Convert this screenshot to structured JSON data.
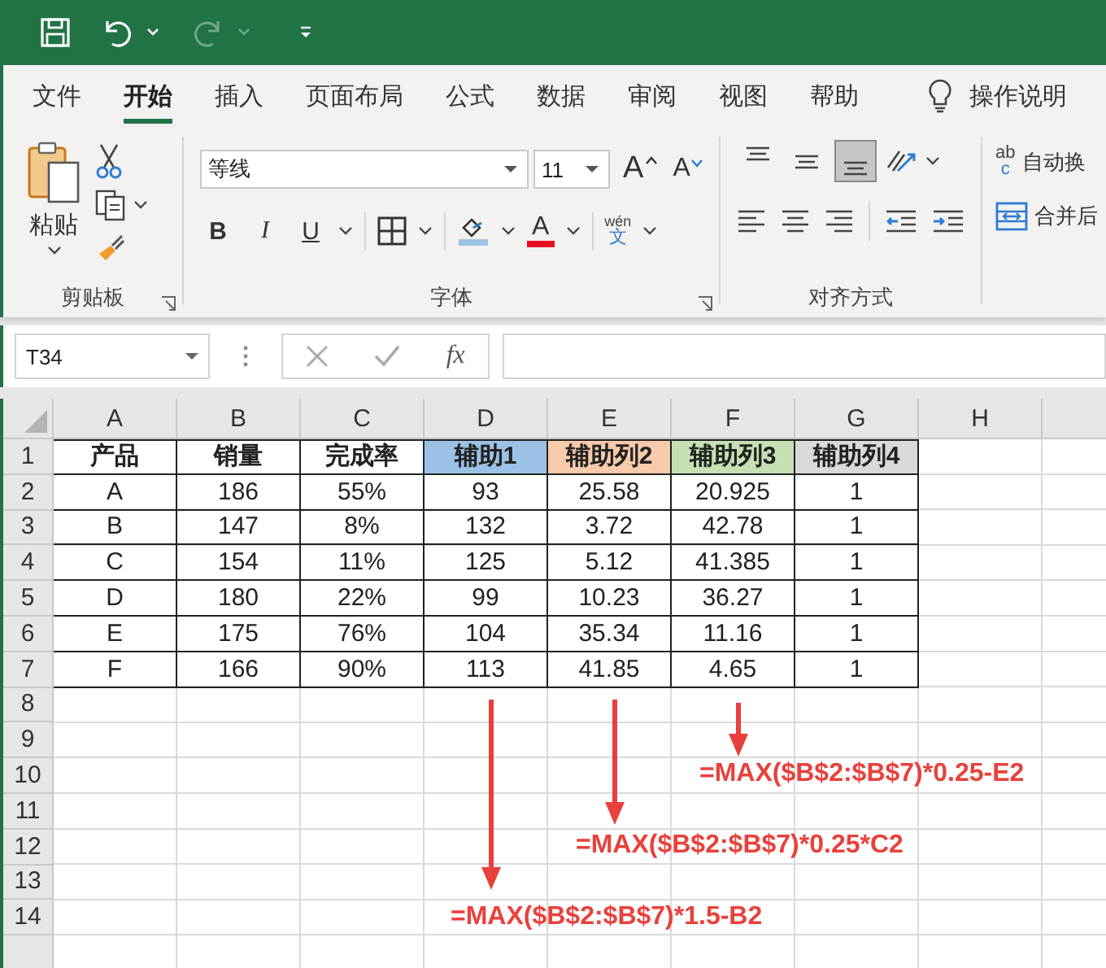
{
  "quick_access": {
    "redo_disabled": true
  },
  "ribbon_tabs": [
    {
      "label": "文件",
      "selected": false
    },
    {
      "label": "开始",
      "selected": true
    },
    {
      "label": "插入",
      "selected": false
    },
    {
      "label": "页面布局",
      "selected": false
    },
    {
      "label": "公式",
      "selected": false
    },
    {
      "label": "数据",
      "selected": false
    },
    {
      "label": "审阅",
      "selected": false
    },
    {
      "label": "视图",
      "selected": false
    },
    {
      "label": "帮助",
      "selected": false
    }
  ],
  "tell_me": "操作说明",
  "clipboard": {
    "paste": "粘贴",
    "group": "剪贴板"
  },
  "font": {
    "name": "等线",
    "size": "11",
    "grow": "A",
    "shrink": "A",
    "bold": "B",
    "italic": "I",
    "underline": "U",
    "font_color": "A",
    "phonetic_top": "wén",
    "phonetic_bottom": "文",
    "group": "字体"
  },
  "alignment": {
    "vertical": [
      {
        "selected": false
      },
      {
        "selected": false
      },
      {
        "selected": true
      }
    ],
    "group": "对齐方式"
  },
  "wrap": {
    "glyph_top": "ab",
    "glyph_bottom": "c",
    "label": "自动换"
  },
  "merge": {
    "label": "合并后"
  },
  "formula_bar": {
    "name_box": "T34",
    "fx": "fx"
  },
  "sheet": {
    "columns": [
      "A",
      "B",
      "C",
      "D",
      "E",
      "F",
      "G",
      "H"
    ],
    "row_numbers": [
      "1",
      "2",
      "3",
      "4",
      "5",
      "6",
      "7",
      "8",
      "9",
      "10",
      "11",
      "12",
      "13",
      "14"
    ],
    "header": [
      {
        "text": "产品"
      },
      {
        "text": "销量"
      },
      {
        "text": "完成率"
      },
      {
        "text": "辅助1",
        "color": "#9bc2e6"
      },
      {
        "text": "辅助列2",
        "color": "#f8cbad"
      },
      {
        "text": "辅助列3",
        "color": "#c6e0b4"
      },
      {
        "text": "辅助列4",
        "color": "#d9d9d9"
      }
    ],
    "rows": [
      [
        "A",
        "186",
        "55%",
        "93",
        "25.58",
        "20.925",
        "1"
      ],
      [
        "B",
        "147",
        "8%",
        "132",
        "3.72",
        "42.78",
        "1"
      ],
      [
        "C",
        "154",
        "11%",
        "125",
        "5.12",
        "41.385",
        "1"
      ],
      [
        "D",
        "180",
        "22%",
        "99",
        "10.23",
        "36.27",
        "1"
      ],
      [
        "E",
        "175",
        "76%",
        "104",
        "35.34",
        "11.16",
        "1"
      ],
      [
        "F",
        "166",
        "90%",
        "113",
        "41.85",
        "4.65",
        "1"
      ]
    ]
  },
  "annotations": [
    {
      "text": "=MAX($B$2:$B$7)*0.25-E2"
    },
    {
      "text": "=MAX($B$2:$B$7)*0.25*C2"
    },
    {
      "text": "=MAX($B$2:$B$7)*1.5-B2"
    }
  ]
}
